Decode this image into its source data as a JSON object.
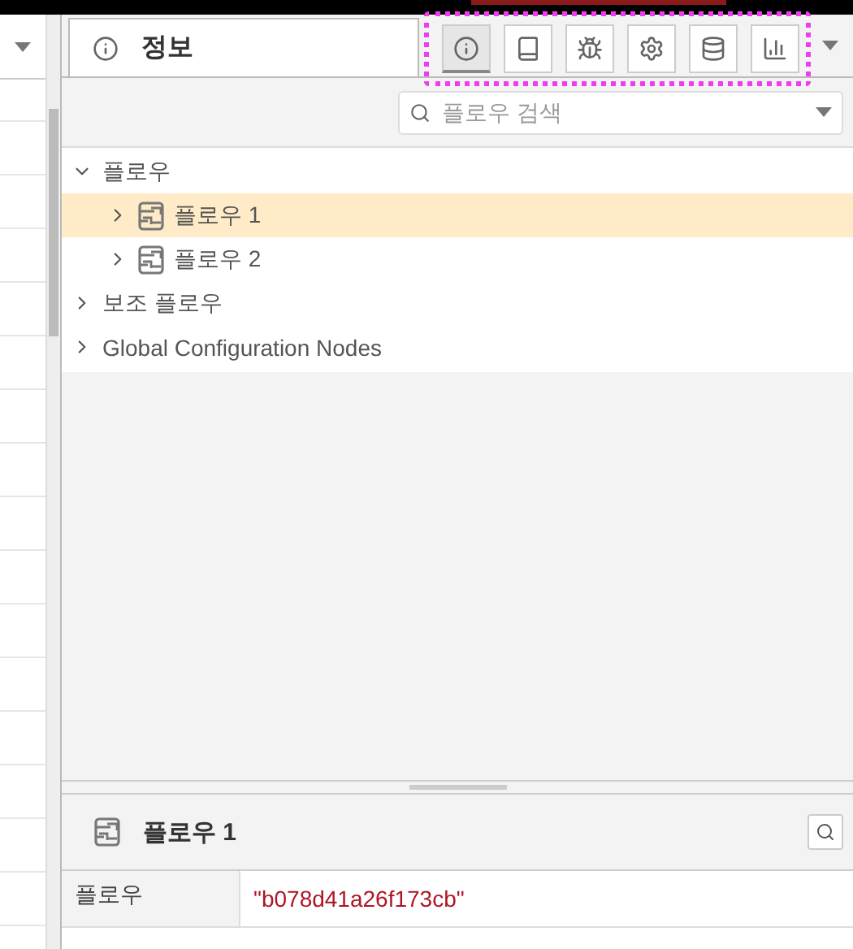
{
  "sidebar": {
    "tab": {
      "title": "정보"
    },
    "tools": [
      {
        "kind": "info",
        "selected": true
      },
      {
        "kind": "book",
        "selected": false
      },
      {
        "kind": "bug",
        "selected": false
      },
      {
        "kind": "gear",
        "selected": false
      },
      {
        "kind": "database",
        "selected": false
      },
      {
        "kind": "chart",
        "selected": false
      }
    ],
    "search": {
      "placeholder": "플로우 검색"
    },
    "tree": [
      {
        "label": "플로우",
        "expanded": true,
        "selected": false,
        "children": [
          {
            "label": "플로우 1",
            "kind": "flow",
            "expanded": false,
            "selected": true
          },
          {
            "label": "플로우 2",
            "kind": "flow",
            "expanded": false,
            "selected": false
          }
        ]
      },
      {
        "label": "보조 플로우",
        "expanded": false,
        "selected": false
      },
      {
        "label": "Global Configuration Nodes",
        "expanded": false,
        "selected": false
      }
    ]
  },
  "details": {
    "title": "플로우 1",
    "properties": [
      {
        "key": "플로우",
        "value": "\"b078d41a26f173cb\""
      }
    ]
  }
}
